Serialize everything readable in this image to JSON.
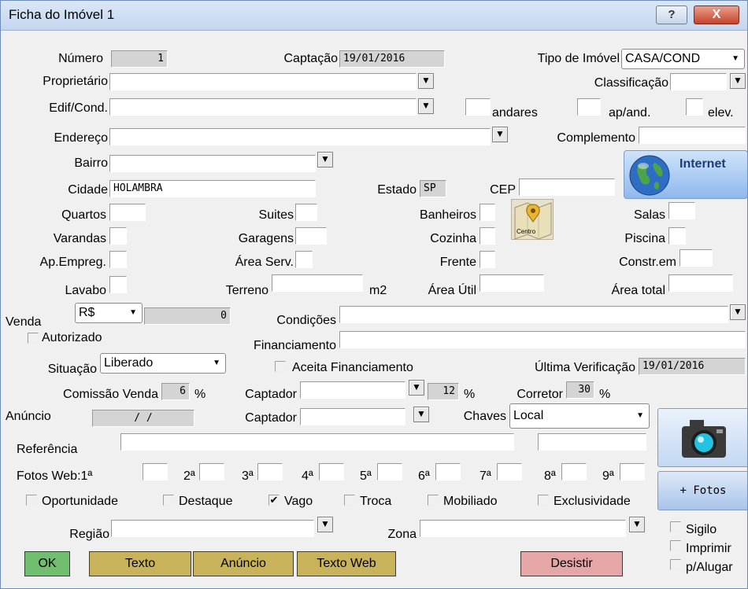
{
  "window": {
    "title": "Ficha do Imóvel 1",
    "help_label": "?",
    "close_label": "X"
  },
  "fields": {
    "numero": {
      "label": "Número",
      "value": "1"
    },
    "captacao": {
      "label": "Captação",
      "value": "19/01/2016"
    },
    "tipo_imovel": {
      "label": "Tipo de Imóvel",
      "value": "CASA/COND"
    },
    "proprietario": {
      "label": "Proprietário",
      "value": ""
    },
    "classificacao": {
      "label": "Classificação",
      "value": ""
    },
    "edif_cond": {
      "label": "Edif/Cond.",
      "value": ""
    },
    "andares": {
      "label": "andares",
      "value": ""
    },
    "ap_and": {
      "label": "ap/and.",
      "value": ""
    },
    "elev": {
      "label": "elev.",
      "value": ""
    },
    "endereco": {
      "label": "Endereço",
      "value": ""
    },
    "complemento": {
      "label": "Complemento",
      "value": ""
    },
    "bairro": {
      "label": "Bairro",
      "value": ""
    },
    "cidade": {
      "label": "Cidade",
      "value": "HOLAMBRA"
    },
    "estado": {
      "label": "Estado",
      "value": "SP"
    },
    "cep": {
      "label": "CEP",
      "value": ""
    },
    "quartos": {
      "label": "Quartos",
      "value": ""
    },
    "suites": {
      "label": "Suites",
      "value": ""
    },
    "banheiros": {
      "label": "Banheiros",
      "value": ""
    },
    "salas": {
      "label": "Salas",
      "value": ""
    },
    "varandas": {
      "label": "Varandas",
      "value": ""
    },
    "garagens": {
      "label": "Garagens",
      "value": ""
    },
    "cozinha": {
      "label": "Cozinha",
      "value": ""
    },
    "piscina": {
      "label": "Piscina",
      "value": ""
    },
    "ap_empreg": {
      "label": "Ap.Empreg.",
      "value": ""
    },
    "area_serv": {
      "label": "Área Serv.",
      "value": ""
    },
    "frente": {
      "label": "Frente",
      "value": ""
    },
    "constr_em": {
      "label": "Constr.em",
      "value": ""
    },
    "lavabo": {
      "label": "Lavabo",
      "value": ""
    },
    "terreno": {
      "label": "Terreno",
      "value": "",
      "unit": "m2"
    },
    "area_util": {
      "label": "Área Útil",
      "value": ""
    },
    "area_total": {
      "label": "Área total",
      "value": ""
    },
    "venda": {
      "label": "Venda",
      "currency": "R$",
      "value": "0"
    },
    "condicoes": {
      "label": "Condições",
      "value": ""
    },
    "autorizado": {
      "label": "Autorizado",
      "checked": false
    },
    "financiamento": {
      "label": "Financiamento",
      "value": ""
    },
    "situacao": {
      "label": "Situação",
      "value": "Liberado"
    },
    "aceita_financiamento": {
      "label": "Aceita Financiamento",
      "checked": false
    },
    "ultima_verificacao": {
      "label": "Última Verificação",
      "value": "19/01/2016"
    },
    "comissao_venda": {
      "label": "Comissão Venda",
      "value": "6",
      "unit": "%"
    },
    "captador1": {
      "label": "Captador",
      "value": "",
      "pct": "12",
      "unit": "%"
    },
    "corretor": {
      "label": "Corretor",
      "value": "30",
      "unit": "%"
    },
    "anuncio": {
      "label": "Anúncio",
      "value": "/ /"
    },
    "captador2": {
      "label": "Captador",
      "value": ""
    },
    "chaves": {
      "label": "Chaves",
      "value": "Local"
    },
    "referencia": {
      "label": "Referência",
      "value": ""
    },
    "regiao": {
      "label": "Região",
      "value": ""
    },
    "zona": {
      "label": "Zona",
      "value": ""
    }
  },
  "fotos_web": {
    "label": "Fotos Web:1ª",
    "slots": [
      "2ª",
      "3ª",
      "4ª",
      "5ª",
      "6ª",
      "7ª",
      "8ª",
      "9ª"
    ]
  },
  "checkboxes": {
    "oportunidade": {
      "label": "Oportunidade",
      "checked": false
    },
    "destaque": {
      "label": "Destaque",
      "checked": false
    },
    "vago": {
      "label": "Vago",
      "checked": true
    },
    "troca": {
      "label": "Troca",
      "checked": false
    },
    "mobiliado": {
      "label": "Mobiliado",
      "checked": false
    },
    "exclusividade": {
      "label": "Exclusividade",
      "checked": false
    },
    "sigilo": {
      "label": "Sigilo",
      "checked": false
    },
    "imprimir": {
      "label": "Imprimir",
      "checked": false
    },
    "p_alugar": {
      "label": "p/Alugar",
      "checked": false
    }
  },
  "buttons": {
    "ok": "OK",
    "texto": "Texto",
    "anuncio": "Anúncio",
    "texto_web": "Texto Web",
    "desistir": "Desistir",
    "internet": "Internet",
    "fotos": "+ Fotos"
  },
  "map_label": "Centro",
  "icons": {
    "dropdown": "dropdown-arrow-icon",
    "globe": "globe-icon",
    "camera": "camera-icon",
    "map": "map-pin-icon"
  }
}
